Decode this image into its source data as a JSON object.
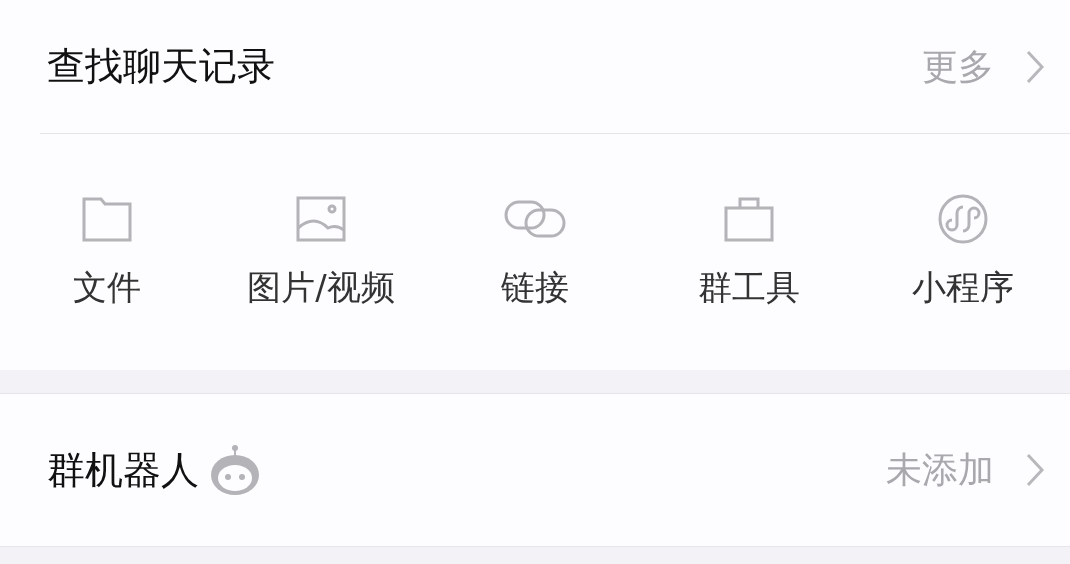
{
  "search_history": {
    "title": "查找聊天记录",
    "more": "更多",
    "categories": [
      {
        "kind": "folder",
        "label": "文件"
      },
      {
        "kind": "image",
        "label": "图片/视频"
      },
      {
        "kind": "link",
        "label": "链接"
      },
      {
        "kind": "toolbox",
        "label": "群工具"
      },
      {
        "kind": "miniapp",
        "label": "小程序"
      }
    ]
  },
  "group_bot": {
    "title": "群机器人",
    "status": "未添加"
  }
}
